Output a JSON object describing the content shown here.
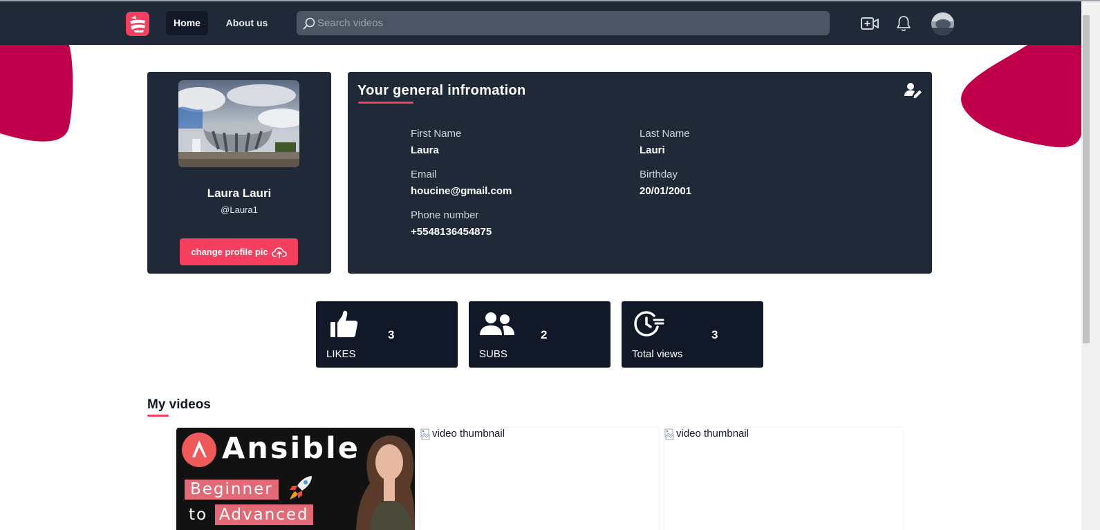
{
  "nav": {
    "home_label": "Home",
    "about_label": "About us",
    "search_placeholder": "Search videos",
    "search_value": ""
  },
  "colors": {
    "navbar": "#1f2937",
    "card": "#1f2937",
    "accent": "#f43f5e",
    "blob": "#c0004b",
    "stat_card": "#111827"
  },
  "profile": {
    "full_name": "Laura Lauri",
    "handle": "@Laura1",
    "change_pic_label": "change profile pic"
  },
  "info": {
    "title": "Your general infromation",
    "fields": [
      {
        "label": "First Name",
        "value": "Laura"
      },
      {
        "label": "Last Name",
        "value": "Lauri"
      },
      {
        "label": "Email",
        "value": "houcine@gmail.com"
      },
      {
        "label": "Birthday",
        "value": "20/01/2001"
      },
      {
        "label": "Phone number",
        "value": "+5548136454875"
      }
    ]
  },
  "stats": [
    {
      "label": "LIKES",
      "value": "3",
      "icon": "thumbs-up-icon"
    },
    {
      "label": "SUBS",
      "value": "2",
      "icon": "users-icon"
    },
    {
      "label": "Total views",
      "value": "3",
      "icon": "clock-history-icon"
    }
  ],
  "videos": {
    "section_title": "My videos",
    "items": [
      {
        "thumb_title": "Ansible",
        "thumb_line1": "Beginner",
        "thumb_line2_prefix": "to",
        "thumb_line2": "Advanced"
      },
      {
        "alt": "video thumbnail"
      },
      {
        "alt": "video thumbnail"
      }
    ]
  }
}
